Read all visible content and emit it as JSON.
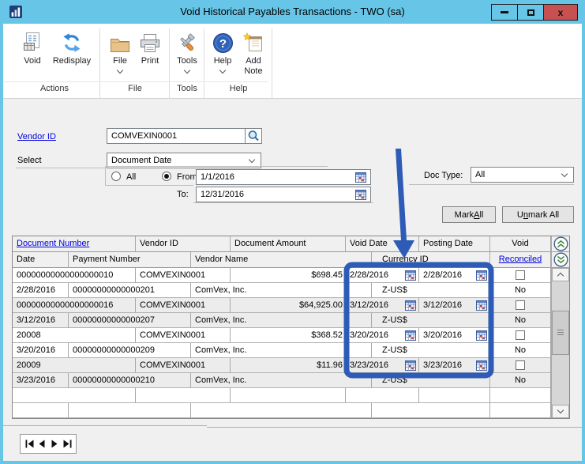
{
  "window": {
    "title": "Void Historical Payables Transactions  -  TWO (sa)"
  },
  "toolbar": {
    "buttons": {
      "void": "Void",
      "redisplay": "Redisplay",
      "file": "File",
      "print": "Print",
      "tools": "Tools",
      "help": "Help",
      "add_note_line1": "Add",
      "add_note_line2": "Note"
    },
    "groups": {
      "actions": "Actions",
      "file": "File",
      "tools": "Tools",
      "help": "Help"
    }
  },
  "form": {
    "vendor_id_label": "Vendor ID",
    "vendor_id_value": "COMVEXIN0001",
    "select_label": "Select",
    "select_value": "Document Date",
    "all_label": "All",
    "from_label": "From:",
    "from_value": "1/1/2016",
    "to_label": "To:",
    "to_value": "12/31/2016",
    "range_selected": "from",
    "doc_type_label": "Doc Type:",
    "doc_type_value": "All",
    "mark_all": {
      "pre": "Mark ",
      "accel": "A",
      "post": "ll"
    },
    "unmark_all": {
      "pre": "U",
      "accel": "n",
      "post": "mark All"
    }
  },
  "table": {
    "headers_row1": {
      "document_number": "Document Number",
      "vendor_id": "Vendor ID",
      "document_amount": "Document Amount",
      "void_date": "Void Date",
      "posting_date": "Posting Date",
      "void": "Void"
    },
    "headers_row2": {
      "date": "Date",
      "payment_number": "Payment Number",
      "vendor_name": "Vendor Name",
      "currency_id": "Currency ID",
      "reconciled": "Reconciled"
    },
    "records": [
      {
        "document_number": "00000000000000000010",
        "vendor_id": "COMVEXIN0001",
        "document_amount": "$698.45",
        "void_date": "2/28/2016",
        "posting_date": "2/28/2016",
        "void_checked": false,
        "date": "2/28/2016",
        "payment_number": "00000000000000201",
        "vendor_name": "ComVex, Inc.",
        "currency_id": "Z-US$",
        "reconciled": "No"
      },
      {
        "document_number": "00000000000000000016",
        "vendor_id": "COMVEXIN0001",
        "document_amount": "$64,925.00",
        "void_date": "3/12/2016",
        "posting_date": "3/12/2016",
        "void_checked": false,
        "date": "3/12/2016",
        "payment_number": "00000000000000207",
        "vendor_name": "ComVex, Inc.",
        "currency_id": "Z-US$",
        "reconciled": "No"
      },
      {
        "document_number": "20008",
        "vendor_id": "COMVEXIN0001",
        "document_amount": "$368.52",
        "void_date": "3/20/2016",
        "posting_date": "3/20/2016",
        "void_checked": false,
        "date": "3/20/2016",
        "payment_number": "00000000000000209",
        "vendor_name": "ComVex, Inc.",
        "currency_id": "Z-US$",
        "reconciled": "No"
      },
      {
        "document_number": "20009",
        "vendor_id": "COMVEXIN0001",
        "document_amount": "$11.96",
        "void_date": "3/23/2016",
        "posting_date": "3/23/2016",
        "void_checked": false,
        "date": "3/23/2016",
        "payment_number": "00000000000000210",
        "vendor_name": "ComVex, Inc.",
        "currency_id": "Z-US$",
        "reconciled": "No"
      }
    ]
  },
  "icons": {
    "app": "bar-chart-window-icon",
    "void": "journal-document-icon",
    "redisplay": "refresh-arrows-icon",
    "file": "folder-icon",
    "print": "printer-icon",
    "tools": "wrench-screwdriver-icon",
    "help": "question-mark-icon",
    "add_note": "note-with-star-icon",
    "lookup": "magnifier-icon",
    "calendar": "calendar-grid-icon",
    "dropdown": "chevron-down-icon",
    "expand_rows": "double-chevron-up-icon",
    "collapse_rows": "double-chevron-down-icon"
  },
  "colors": {
    "titlebar": "#67c6e8",
    "close_button": "#c75050",
    "annotation": "#2d5bb5",
    "link": "#0000dd",
    "row_alt": "#ececec"
  }
}
